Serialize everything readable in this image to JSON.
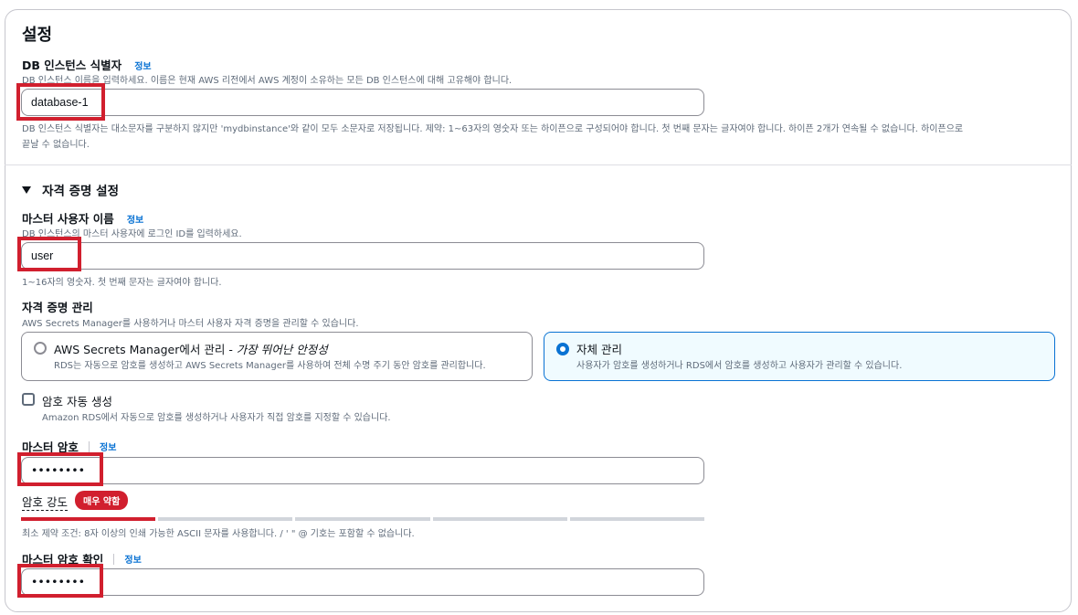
{
  "settings": {
    "title": "설정",
    "identifier": {
      "label": "DB 인스턴스 식별자",
      "info": "정보",
      "description": "DB 인스턴스 이름을 입력하세요. 이름은 현재 AWS 리전에서 AWS 계정이 소유하는 모든 DB 인스턴스에 대해 고유해야 합니다.",
      "value": "database-1",
      "hint_line1": "DB 인스턴스 식별자는 대소문자를 구분하지 않지만 'mydbinstance'와 같이 모두 소문자로 저장됩니다. 제약: 1~63자의 영숫자 또는 하이픈으로 구성되어야 합니다. 첫 번째 문자는 글자여야 합니다. 하이픈 2개가 연속될 수 없습니다. 하이픈으로",
      "hint_line2": "끝날 수 없습니다."
    }
  },
  "credentials": {
    "toggle_icon": "caret-down-icon",
    "title": "자격 증명 설정",
    "master_username": {
      "label": "마스터 사용자 이름",
      "info": "정보",
      "description": "DB 인스턴스의 마스터 사용자에 로그인 ID를 입력하세요.",
      "value": "user",
      "hint": "1~16자의 영숫자. 첫 번째 문자는 글자여야 합니다."
    },
    "management": {
      "label": "자격 증명 관리",
      "description": "AWS Secrets Manager를 사용하거나 마스터 사용자 자격 증명을 관리할 수 있습니다.",
      "options": [
        {
          "title": "AWS Secrets Manager에서 관리 - ",
          "title_emphasis": "가장 뛰어난 안정성",
          "description": "RDS는 자동으로 암호를 생성하고 AWS Secrets Manager를 사용하여 전체 수명 주기 동안 암호를 관리합니다.",
          "selected": false
        },
        {
          "title": "자체 관리",
          "description": "사용자가 암호를 생성하거나 RDS에서 암호를 생성하고 사용자가 관리할 수 있습니다.",
          "selected": true
        }
      ]
    },
    "auto_generate": {
      "label": "암호 자동 생성",
      "description": "Amazon RDS에서 자동으로 암호를 생성하거나 사용자가 직접 암호를 지정할 수 있습니다.",
      "checked": false
    },
    "master_password": {
      "label": "마스터 암호",
      "info": "정보",
      "masked_value": "••••••••",
      "strength_label": "암호 강도",
      "strength_badge": "매우 약함",
      "strength_level_fraction": 0.2,
      "constraint": "최소 제약 조건: 8자 이상의 인쇄 가능한 ASCII 문자를 사용합니다. / ' \" @ 기호는 포함할 수 없습니다."
    },
    "confirm_password": {
      "label": "마스터 암호 확인",
      "info": "정보",
      "masked_value": "••••••••"
    }
  },
  "colors": {
    "accent": "#0972d3",
    "selected_tile_bg": "#f0fbff",
    "strength_weak": "#d11f2e",
    "highlight_box": "#d11f2e"
  }
}
